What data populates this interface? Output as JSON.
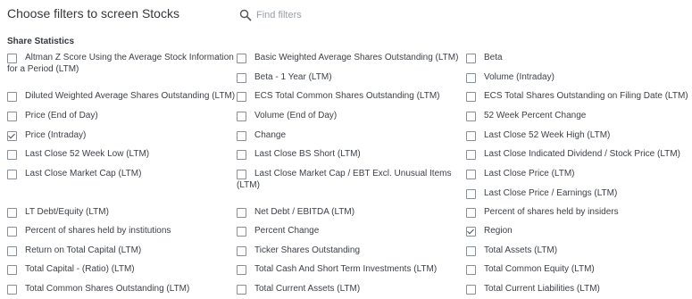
{
  "header": {
    "title": "Choose filters to screen Stocks",
    "search_placeholder": "Find filters"
  },
  "section": {
    "title": "Share Statistics"
  },
  "filters": {
    "altman": {
      "label": "Altman Z Score Using the Average Stock Information",
      "label_cont": "for a Period (LTM)",
      "checked": false
    },
    "basic_wso": {
      "label": "Basic Weighted Average Shares Outstanding (LTM)",
      "checked": false
    },
    "beta": {
      "label": "Beta",
      "checked": false
    },
    "beta_1y": {
      "label": "Beta - 1 Year (LTM)",
      "checked": false
    },
    "volume_intraday": {
      "label": "Volume (Intraday)",
      "checked": false
    },
    "diluted_wso": {
      "label": "Diluted Weighted Average Shares Outstanding (LTM)",
      "checked": false
    },
    "ecs_total_common": {
      "label": "ECS Total Common Shares Outstanding (LTM)",
      "checked": false
    },
    "ecs_total_filing": {
      "label": "ECS Total Shares Outstanding on Filing Date (LTM)",
      "checked": false
    },
    "price_eod": {
      "label": "Price (End of Day)",
      "checked": false
    },
    "volume_eod": {
      "label": "Volume (End of Day)",
      "checked": false
    },
    "pct_52w": {
      "label": "52 Week Percent Change",
      "checked": false
    },
    "price_intraday": {
      "label": "Price (Intraday)",
      "checked": true
    },
    "change": {
      "label": "Change",
      "checked": false
    },
    "lc_52w_high": {
      "label": "Last Close 52 Week High (LTM)",
      "checked": false
    },
    "lc_52w_low": {
      "label": "Last Close 52 Week Low (LTM)",
      "checked": false
    },
    "lc_bs_short": {
      "label": "Last Close BS Short (LTM)",
      "checked": false
    },
    "lc_div_price": {
      "label": "Last Close Indicated Dividend / Stock Price (LTM)",
      "checked": false
    },
    "lc_mktcap": {
      "label": "Last Close Market Cap (LTM)",
      "checked": false
    },
    "lc_mktcap_ebt": {
      "label": "Last Close Market Cap / EBT Excl. Unusual Items",
      "label_cont": "(LTM)",
      "checked": false
    },
    "lc_price": {
      "label": "Last Close Price (LTM)",
      "checked": false
    },
    "lc_pe": {
      "label": "Last Close Price / Earnings (LTM)",
      "checked": false
    },
    "lt_debt_eq": {
      "label": "LT Debt/Equity (LTM)",
      "checked": false
    },
    "net_debt_ebitda": {
      "label": "Net Debt / EBITDA (LTM)",
      "checked": false
    },
    "pct_insiders": {
      "label": "Percent of shares held by insiders",
      "checked": false
    },
    "pct_institutions": {
      "label": "Percent of shares held by institutions",
      "checked": false
    },
    "percent_change": {
      "label": "Percent Change",
      "checked": false
    },
    "region": {
      "label": "Region",
      "checked": true
    },
    "roc": {
      "label": "Return on Total Capital (LTM)",
      "checked": false
    },
    "ticker_shares": {
      "label": "Ticker Shares Outstanding",
      "checked": false
    },
    "total_assets": {
      "label": "Total Assets (LTM)",
      "checked": false
    },
    "total_capital_ratio": {
      "label": "Total Capital - (Ratio) (LTM)",
      "checked": false
    },
    "total_cash_sti": {
      "label": "Total Cash And Short Term Investments (LTM)",
      "checked": false
    },
    "total_common_equity": {
      "label": "Total Common Equity (LTM)",
      "checked": false
    },
    "total_common_shares": {
      "label": "Total Common Shares Outstanding (LTM)",
      "checked": false
    },
    "total_current_assets": {
      "label": "Total Current Assets (LTM)",
      "checked": false
    },
    "total_current_liab": {
      "label": "Total Current Liabilities (LTM)",
      "checked": false
    }
  }
}
